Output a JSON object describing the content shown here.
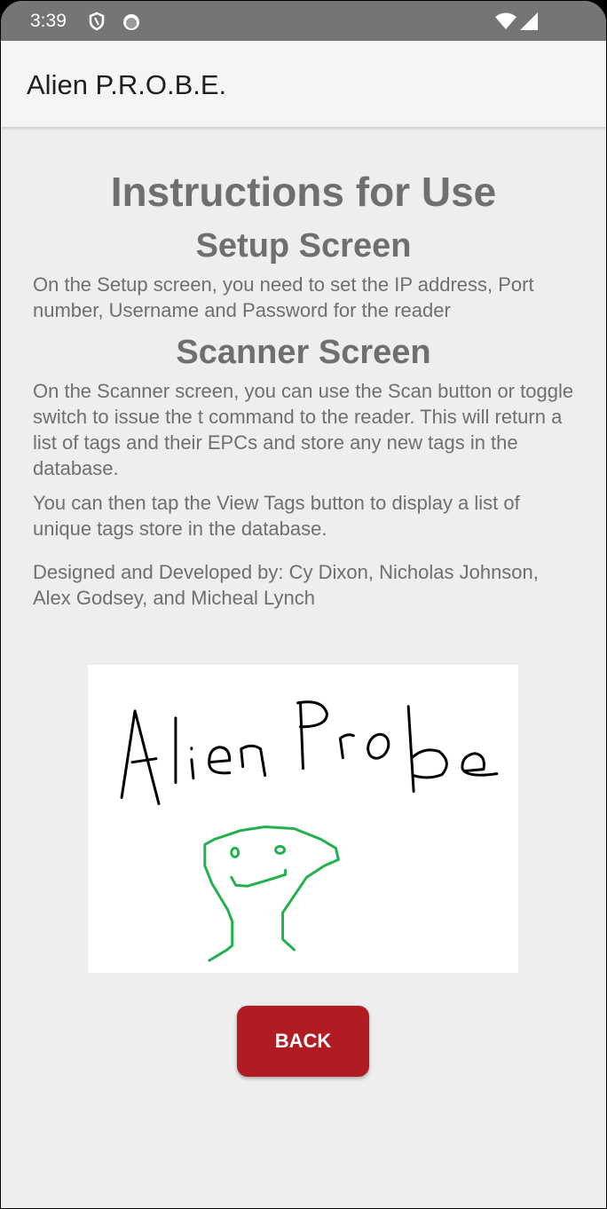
{
  "status_bar": {
    "time": "3:39",
    "icons": [
      "shield-icon",
      "cat-face-icon",
      "wifi-icon",
      "cell-signal-icon"
    ]
  },
  "app_bar": {
    "title": "Alien P.R.O.B.E."
  },
  "content": {
    "title": "Instructions for Use",
    "setup_heading": "Setup Screen",
    "setup_text": "On the Setup screen, you need to set the IP address, Port number, Username and Password for the reader",
    "scanner_heading": "Scanner Screen",
    "scanner_text_1": "On the Scanner screen, you can use the Scan button or toggle switch to issue the t command to the reader. This will return a list of tags and their EPCs and store any new tags in the database.",
    "scanner_text_2": "You can then tap the View Tags button to display a list of unique tags store in the database.",
    "credits": "Designed and Developed by: Cy Dixon, Nicholas Johnson, Alex Godsey, and Micheal Lynch",
    "logo_text": "Alien Probe"
  },
  "back_button": {
    "label": "BACK",
    "color": "#b11b22"
  }
}
